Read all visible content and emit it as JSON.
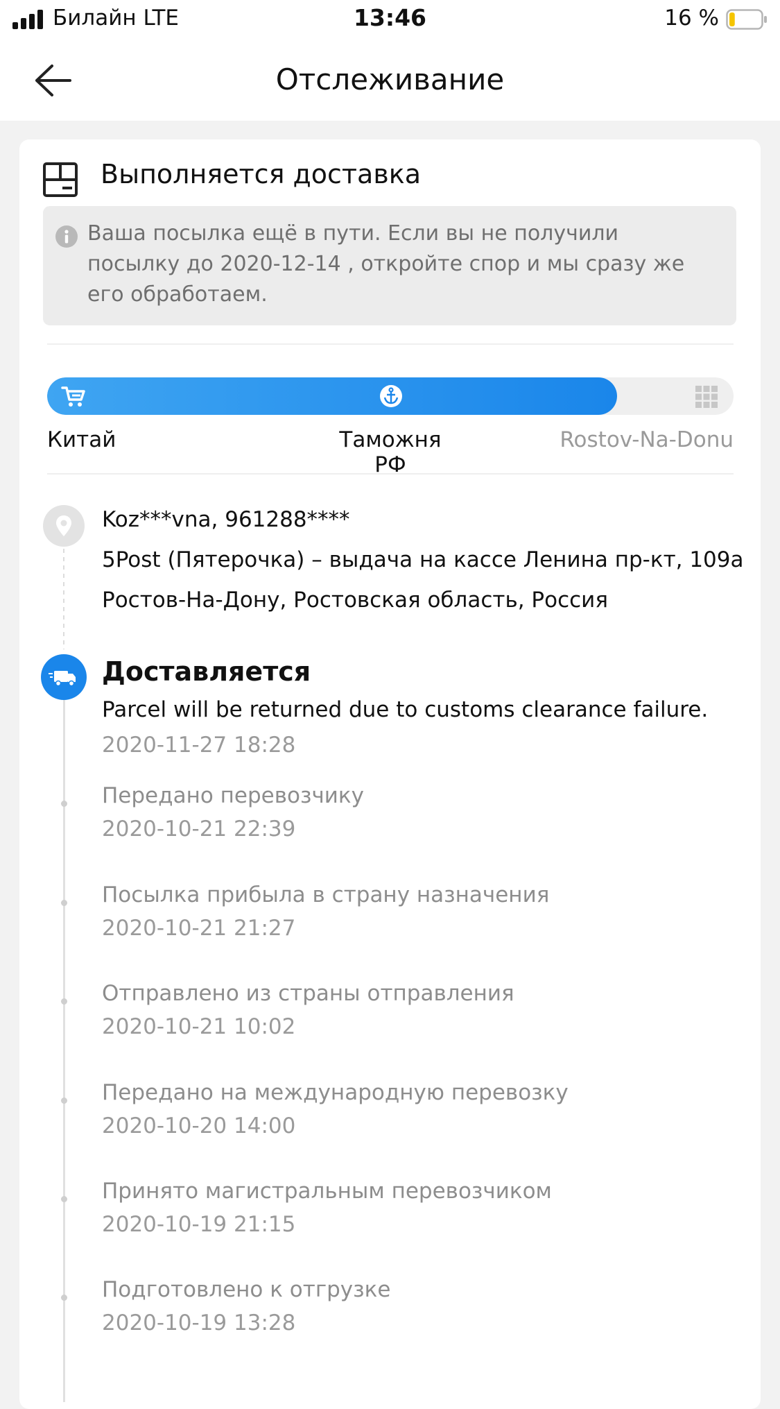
{
  "status_bar": {
    "carrier": "Билайн   LTE",
    "time": "13:46",
    "battery_percent": "16 %",
    "battery_level": 0.16
  },
  "nav": {
    "title": "Отслеживание"
  },
  "delivery": {
    "header_title": "Выполняется доставка",
    "notice": "Ваша посылка ещё в пути. Если вы не получили посылку до 2020-12-14 , откройте спор и мы сразу же его обработаем."
  },
  "progress": {
    "fraction": 0.83,
    "stages": [
      "Китай",
      "Таможня РФ",
      "Rostov-Na-Donu"
    ],
    "colors": {
      "active": "#1a86ea",
      "inactive": "#efefef"
    }
  },
  "address": {
    "recipient": "Koz***vna, 961288****",
    "pickup_point": "5Post (Пятерочка) – выдача на кассе Ленина пр-кт, 109а",
    "region": "Ростов-На-Дону, Ростовская область, Россия"
  },
  "current_event": {
    "title": "Доставляется",
    "description": "Parcel will be returned due to customs clearance failure.",
    "time": "2020-11-27 18:28",
    "icon": "truck-icon"
  },
  "events": [
    {
      "title": "Передано перевозчику",
      "time": "2020-10-21 22:39"
    },
    {
      "title": "Посылка прибыла в страну назначения",
      "time": "2020-10-21 21:27"
    },
    {
      "title": "Отправлено из страны отправления",
      "time": "2020-10-21 10:02"
    },
    {
      "title": "Передано на международную перевозку",
      "time": "2020-10-20 14:00"
    },
    {
      "title": "Принято магистральным перевозчиком",
      "time": "2020-10-19 21:15"
    },
    {
      "title": "Подготовлено к отгрузке",
      "time": "2020-10-19 13:28"
    }
  ]
}
